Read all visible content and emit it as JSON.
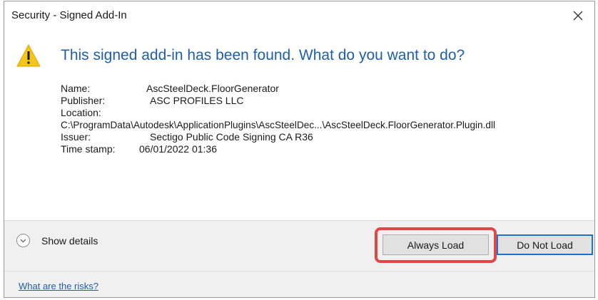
{
  "window": {
    "title": "Security - Signed Add-In",
    "close_glyph": "✕",
    "close_icon": "close-icon"
  },
  "message": {
    "icon": "warning-icon",
    "icon_color": "#f5c518",
    "headline": "This signed add-in has been found. What do you want to do?",
    "headline_color": "#1f5fa8"
  },
  "details": {
    "name_label": "Name:",
    "name_value": "AscSteelDeck.FloorGenerator",
    "publisher_label": "Publisher:",
    "publisher_value": "ASC PROFILES LLC",
    "location_label": "Location:",
    "location_value": "C:\\ProgramData\\Autodesk\\ApplicationPlugins\\AscSteelDec...\\AscSteelDeck.FloorGenerator.Plugin.dll",
    "issuer_label": "Issuer:",
    "issuer_value": "Sectigo Public Code Signing CA R36",
    "timestamp_label": "Time stamp:",
    "timestamp_value": "06/01/2022 01:36"
  },
  "footer": {
    "show_details_label": "Show details",
    "show_details_icon": "chevron-down-icon",
    "always_load_label": "Always Load",
    "do_not_load_label": "Do Not Load",
    "risks_link": "What are the risks?",
    "highlight_color": "#e04848"
  }
}
